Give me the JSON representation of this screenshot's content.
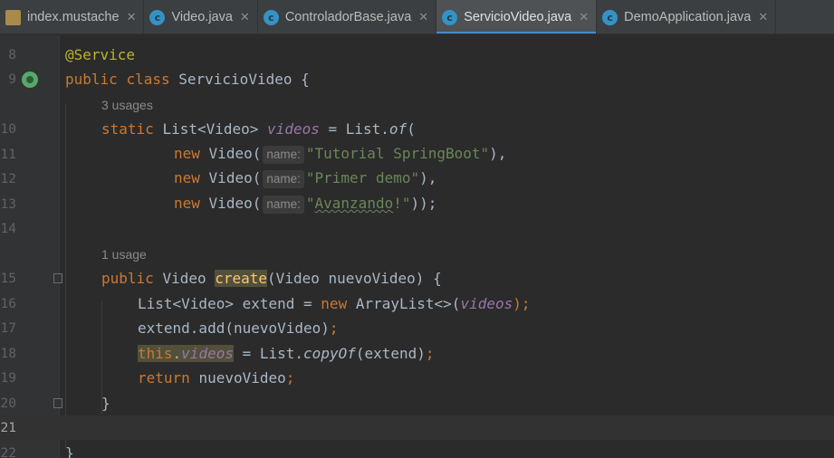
{
  "tabs": [
    {
      "label": "index.mustache",
      "icon": "mustache-file-icon",
      "active": false
    },
    {
      "label": "Video.java",
      "icon": "java-class-icon",
      "active": false
    },
    {
      "label": "ControladorBase.java",
      "icon": "java-class-icon",
      "active": false
    },
    {
      "label": "ServicioVideo.java",
      "icon": "java-class-icon",
      "active": true
    },
    {
      "label": "DemoApplication.java",
      "icon": "spring-app-icon",
      "active": false
    }
  ],
  "tab_close_glyph": "✕",
  "tab_class_glyph": "c",
  "editor": {
    "line_numbers": [
      "8",
      "9",
      "10",
      "11",
      "12",
      "13",
      "14",
      "15",
      "16",
      "17",
      "18",
      "19",
      "20",
      "21",
      "22"
    ],
    "usages": [
      "3 usages",
      "1 usage"
    ],
    "param_hint": "name:",
    "code": {
      "l8_annotation": "@Service",
      "l9_public": "public",
      "l9_class": "class",
      "l9_name": "ServicioVideo {",
      "l10_static": "static",
      "l10_type": "List<Video>",
      "l10_field": "videos",
      "l10_rest": "= List.",
      "l10_of": "of",
      "l10_paren": "(",
      "new": "new",
      "video_open": "Video(",
      "l11_str": "\"Tutorial SpringBoot\"",
      "l11_end": "),",
      "l12_str": "\"Primer demo\"",
      "l12_end": "),",
      "l13_q1": "\"",
      "l13_word": "Avanzando",
      "l13_q2": "!\"",
      "l13_end": "));",
      "l15_public": "public",
      "l15_type": "Video",
      "l15_method": "create",
      "l15_params": "(Video nuevoVideo) {",
      "l16_decl": "List<Video> extend =",
      "l16_new": "new",
      "l16_ctor": "ArrayList<>(",
      "l16_field": "videos",
      "l16_end": ");",
      "l17": "extend.add(nuevoVideo)",
      "l17_semi": ";",
      "l18_this": "this",
      "l18_dot": ".",
      "l18_field": "videos",
      "l18_mid": "= List.",
      "l18_copy": "copyOf",
      "l18_args": "(extend)",
      "l18_semi": ";",
      "l19_return": "return",
      "l19_val": "nuevoVideo",
      "l19_semi": ";",
      "l20": "}",
      "l22": "}"
    }
  },
  "colors": {
    "background": "#2b2b2b",
    "keyword": "#cc7832",
    "annotation": "#bbb529",
    "string": "#6a8759",
    "field": "#9876aa",
    "text": "#a9b7c6",
    "active_tab_underline": "#4a88c7"
  }
}
